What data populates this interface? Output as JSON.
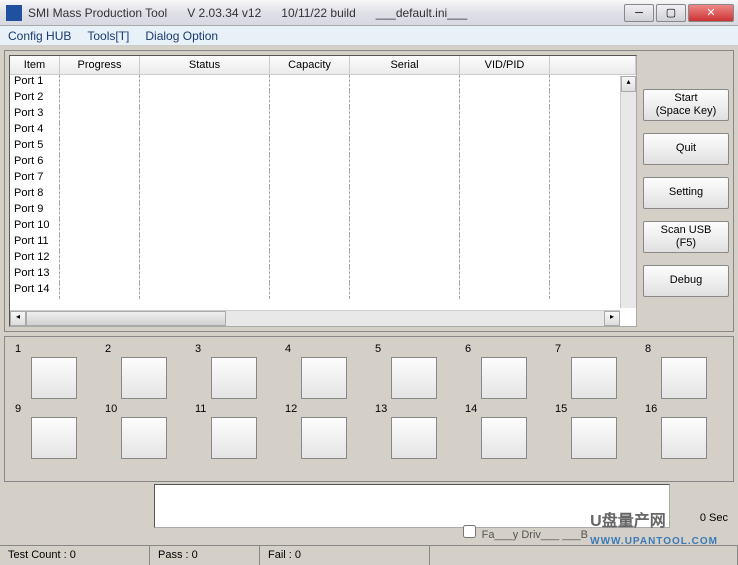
{
  "title": {
    "app": "SMI Mass Production Tool",
    "version": "V 2.03.34   v12",
    "build": "10/11/22 build",
    "config": "___default.ini___"
  },
  "menu": {
    "config_hub": "Config HUB",
    "tools": "Tools[T]",
    "dialog": "Dialog Option"
  },
  "columns": {
    "item": "Item",
    "progress": "Progress",
    "status": "Status",
    "capacity": "Capacity",
    "serial": "Serial",
    "vidpid": "VID/PID"
  },
  "ports": [
    "Port 1",
    "Port 2",
    "Port 3",
    "Port 4",
    "Port 5",
    "Port 6",
    "Port 7",
    "Port 8",
    "Port 9",
    "Port 10",
    "Port 11",
    "Port 12",
    "Port 13",
    "Port 14"
  ],
  "buttons": {
    "start": "Start\n(Space Key)",
    "quit": "Quit",
    "setting": "Setting",
    "scan": "Scan USB\n(F5)",
    "debug": "Debug"
  },
  "slots_row1": [
    "1",
    "2",
    "3",
    "4",
    "5",
    "6",
    "7",
    "8"
  ],
  "slots_row2": [
    "9",
    "10",
    "11",
    "12",
    "13",
    "14",
    "15",
    "16"
  ],
  "timer": "0 Sec",
  "checkbox_label": "Fa___y Driv___ ___B",
  "status": {
    "test": "Test Count : 0",
    "pass": "Pass : 0",
    "fail": "Fail : 0"
  },
  "watermark": {
    "cn": "U盘量产网",
    "url": "WWW.UPANTOOL.COM"
  }
}
